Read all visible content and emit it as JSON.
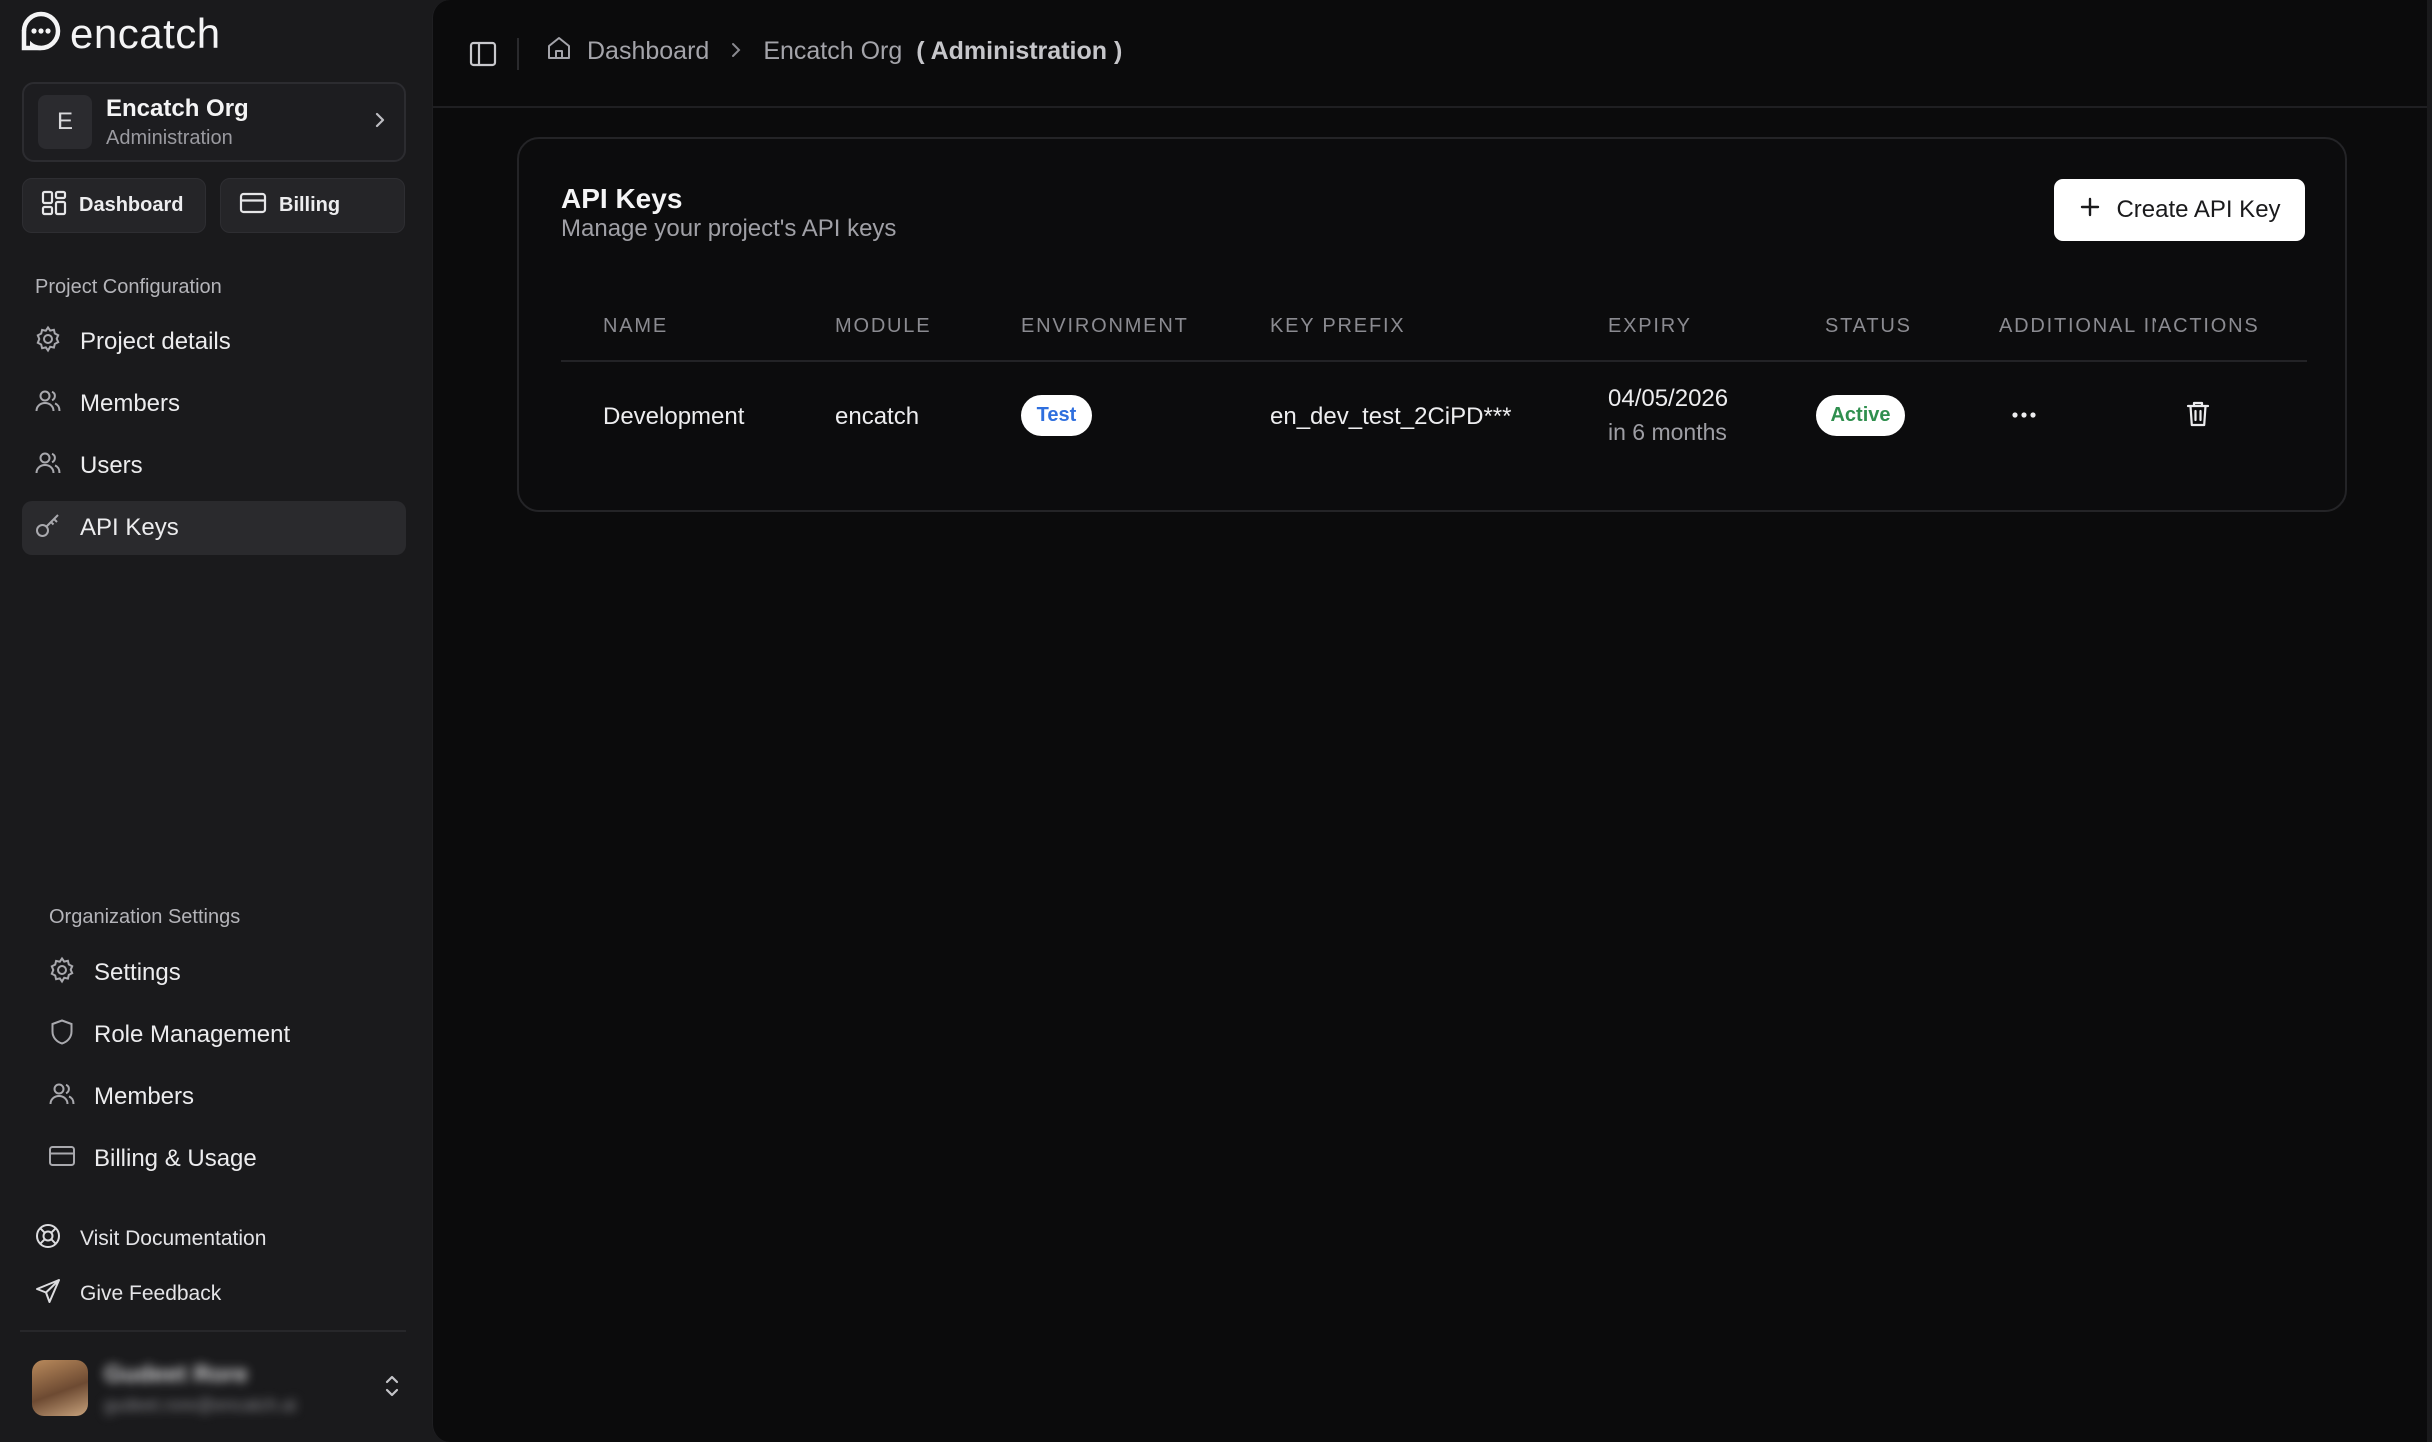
{
  "brand": {
    "name": "encatch",
    "logo_icon": "chat-bubble-logo-icon"
  },
  "org": {
    "initial": "E",
    "name": "Encatch Org",
    "role": "Administration"
  },
  "quick_nav": [
    {
      "label": "Dashboard",
      "icon": "grid-icon"
    },
    {
      "label": "Billing",
      "icon": "credit-card-icon"
    }
  ],
  "project_config": {
    "title": "Project Configuration",
    "items": [
      {
        "label": "Project details",
        "icon": "gear-icon",
        "active": false
      },
      {
        "label": "Members",
        "icon": "users-icon",
        "active": false
      },
      {
        "label": "Users",
        "icon": "users-icon",
        "active": false
      },
      {
        "label": "API Keys",
        "icon": "key-icon",
        "active": true
      }
    ]
  },
  "org_settings": {
    "title": "Organization Settings",
    "items": [
      {
        "label": "Settings",
        "icon": "gear-icon"
      },
      {
        "label": "Role Management",
        "icon": "shield-icon"
      },
      {
        "label": "Members",
        "icon": "users-icon"
      },
      {
        "label": "Billing & Usage",
        "icon": "credit-card-icon"
      }
    ]
  },
  "footer_links": [
    {
      "label": "Visit Documentation",
      "icon": "lifebuoy-icon"
    },
    {
      "label": "Give Feedback",
      "icon": "send-icon"
    }
  ],
  "user": {
    "name": "Gudeet Rore",
    "email": "gudeet.rore@encatch.ai"
  },
  "breadcrumb": {
    "home_label": "Dashboard",
    "org_label": "Encatch Org",
    "org_role": "( Administration )"
  },
  "api_keys": {
    "title": "API Keys",
    "subtitle": "Manage your project's API keys",
    "create_label": "Create API Key",
    "columns": [
      "NAME",
      "MODULE",
      "ENVIRONMENT",
      "KEY PREFIX",
      "EXPIRY",
      "STATUS",
      "ADDITIONAL INFO",
      "ACTIONS"
    ],
    "rows": [
      {
        "name": "Development",
        "module": "encatch",
        "environment": "Test",
        "key_prefix": "en_dev_test_2CiPD***",
        "expiry_date": "04/05/2026",
        "expiry_relative": "in 6 months",
        "status": "Active"
      }
    ]
  },
  "colors": {
    "sidebar_bg": "#1a1a1c",
    "main_bg": "#0b0b0c",
    "env_badge_text": "#2f6fde",
    "status_badge_text": "#2f8f4e"
  }
}
